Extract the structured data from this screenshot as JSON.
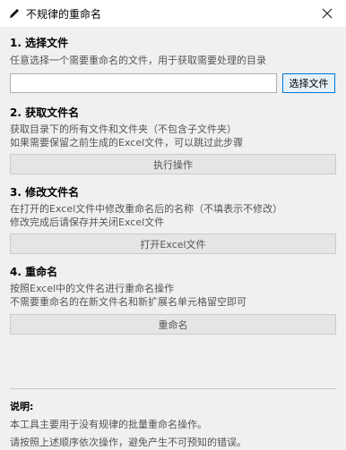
{
  "window": {
    "title": "不规律的重命名",
    "app_icon": "pencil-icon",
    "close_icon": "close-icon"
  },
  "step1": {
    "title": "1. 选择文件",
    "desc": "任意选择一个需要重命名的文件，用于获取需要处理的目录",
    "path_value": "",
    "choose_label": "选择文件"
  },
  "step2": {
    "title": "2. 获取文件名",
    "desc_line1": "获取目录下的所有文件和文件夹（不包含子文件夹）",
    "desc_line2": "如果需要保留之前生成的Excel文件，可以跳过此步骤",
    "button_label": "执行操作"
  },
  "step3": {
    "title": "3. 修改文件名",
    "desc_line1": "在打开的Excel文件中修改重命名后的名称（不填表示不修改）",
    "desc_line2": "修改完成后请保存并关闭Excel文件",
    "button_label": "打开Excel文件"
  },
  "step4": {
    "title": "4. 重命名",
    "desc_line1": "按照Excel中的文件名进行重命名操作",
    "desc_line2": "不需要重命名的在新文件名和新扩展名单元格留空即可",
    "button_label": "重命名"
  },
  "note": {
    "title": "说明:",
    "line1": "本工具主要用于没有规律的批量重命名操作。",
    "line2": "请按照上述顺序依次操作，避免产生不可预知的错误。"
  },
  "colors": {
    "accent": "#0078d7",
    "window_bg": "#f0f0f0",
    "button_bg": "#e5e5e5"
  }
}
